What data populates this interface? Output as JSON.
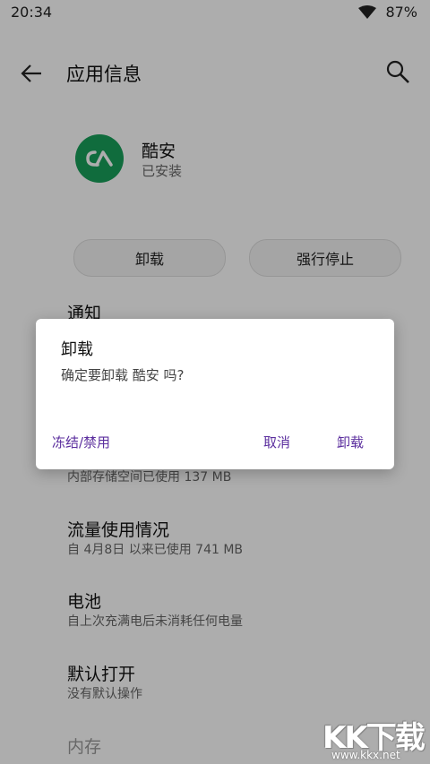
{
  "status_bar": {
    "time": "20:34",
    "battery": "87%",
    "wifi_icon": "wifi-icon"
  },
  "app_bar": {
    "title": "应用信息",
    "back_icon": "back-arrow-icon",
    "search_icon": "search-icon"
  },
  "app": {
    "name": "酷安",
    "status": "已安装",
    "icon": "coolapk-logo",
    "icon_color": "#18a05a"
  },
  "actions": {
    "uninstall": "卸载",
    "force_stop": "强行停止"
  },
  "settings": {
    "notifications": {
      "title": "通知"
    },
    "storage_sub": "内部存储空间已使用 137 MB",
    "data_usage": {
      "title": "流量使用情况",
      "sub": "自 4月8日 以来已使用 741 MB"
    },
    "battery": {
      "title": "电池",
      "sub": "自上次充满电后未消耗任何电量"
    },
    "open_by_default": {
      "title": "默认打开",
      "sub": "没有默认操作"
    },
    "memory": {
      "title": "内存"
    }
  },
  "dialog": {
    "title": "卸载",
    "message": "确定要卸载 酷安 吗?",
    "freeze_button": "冻结/禁用",
    "cancel_button": "取消",
    "confirm_button": "卸载",
    "button_color": "#5b2e9e"
  },
  "watermark": {
    "logo_text": "KK下载",
    "url": "www.kkx.net"
  }
}
